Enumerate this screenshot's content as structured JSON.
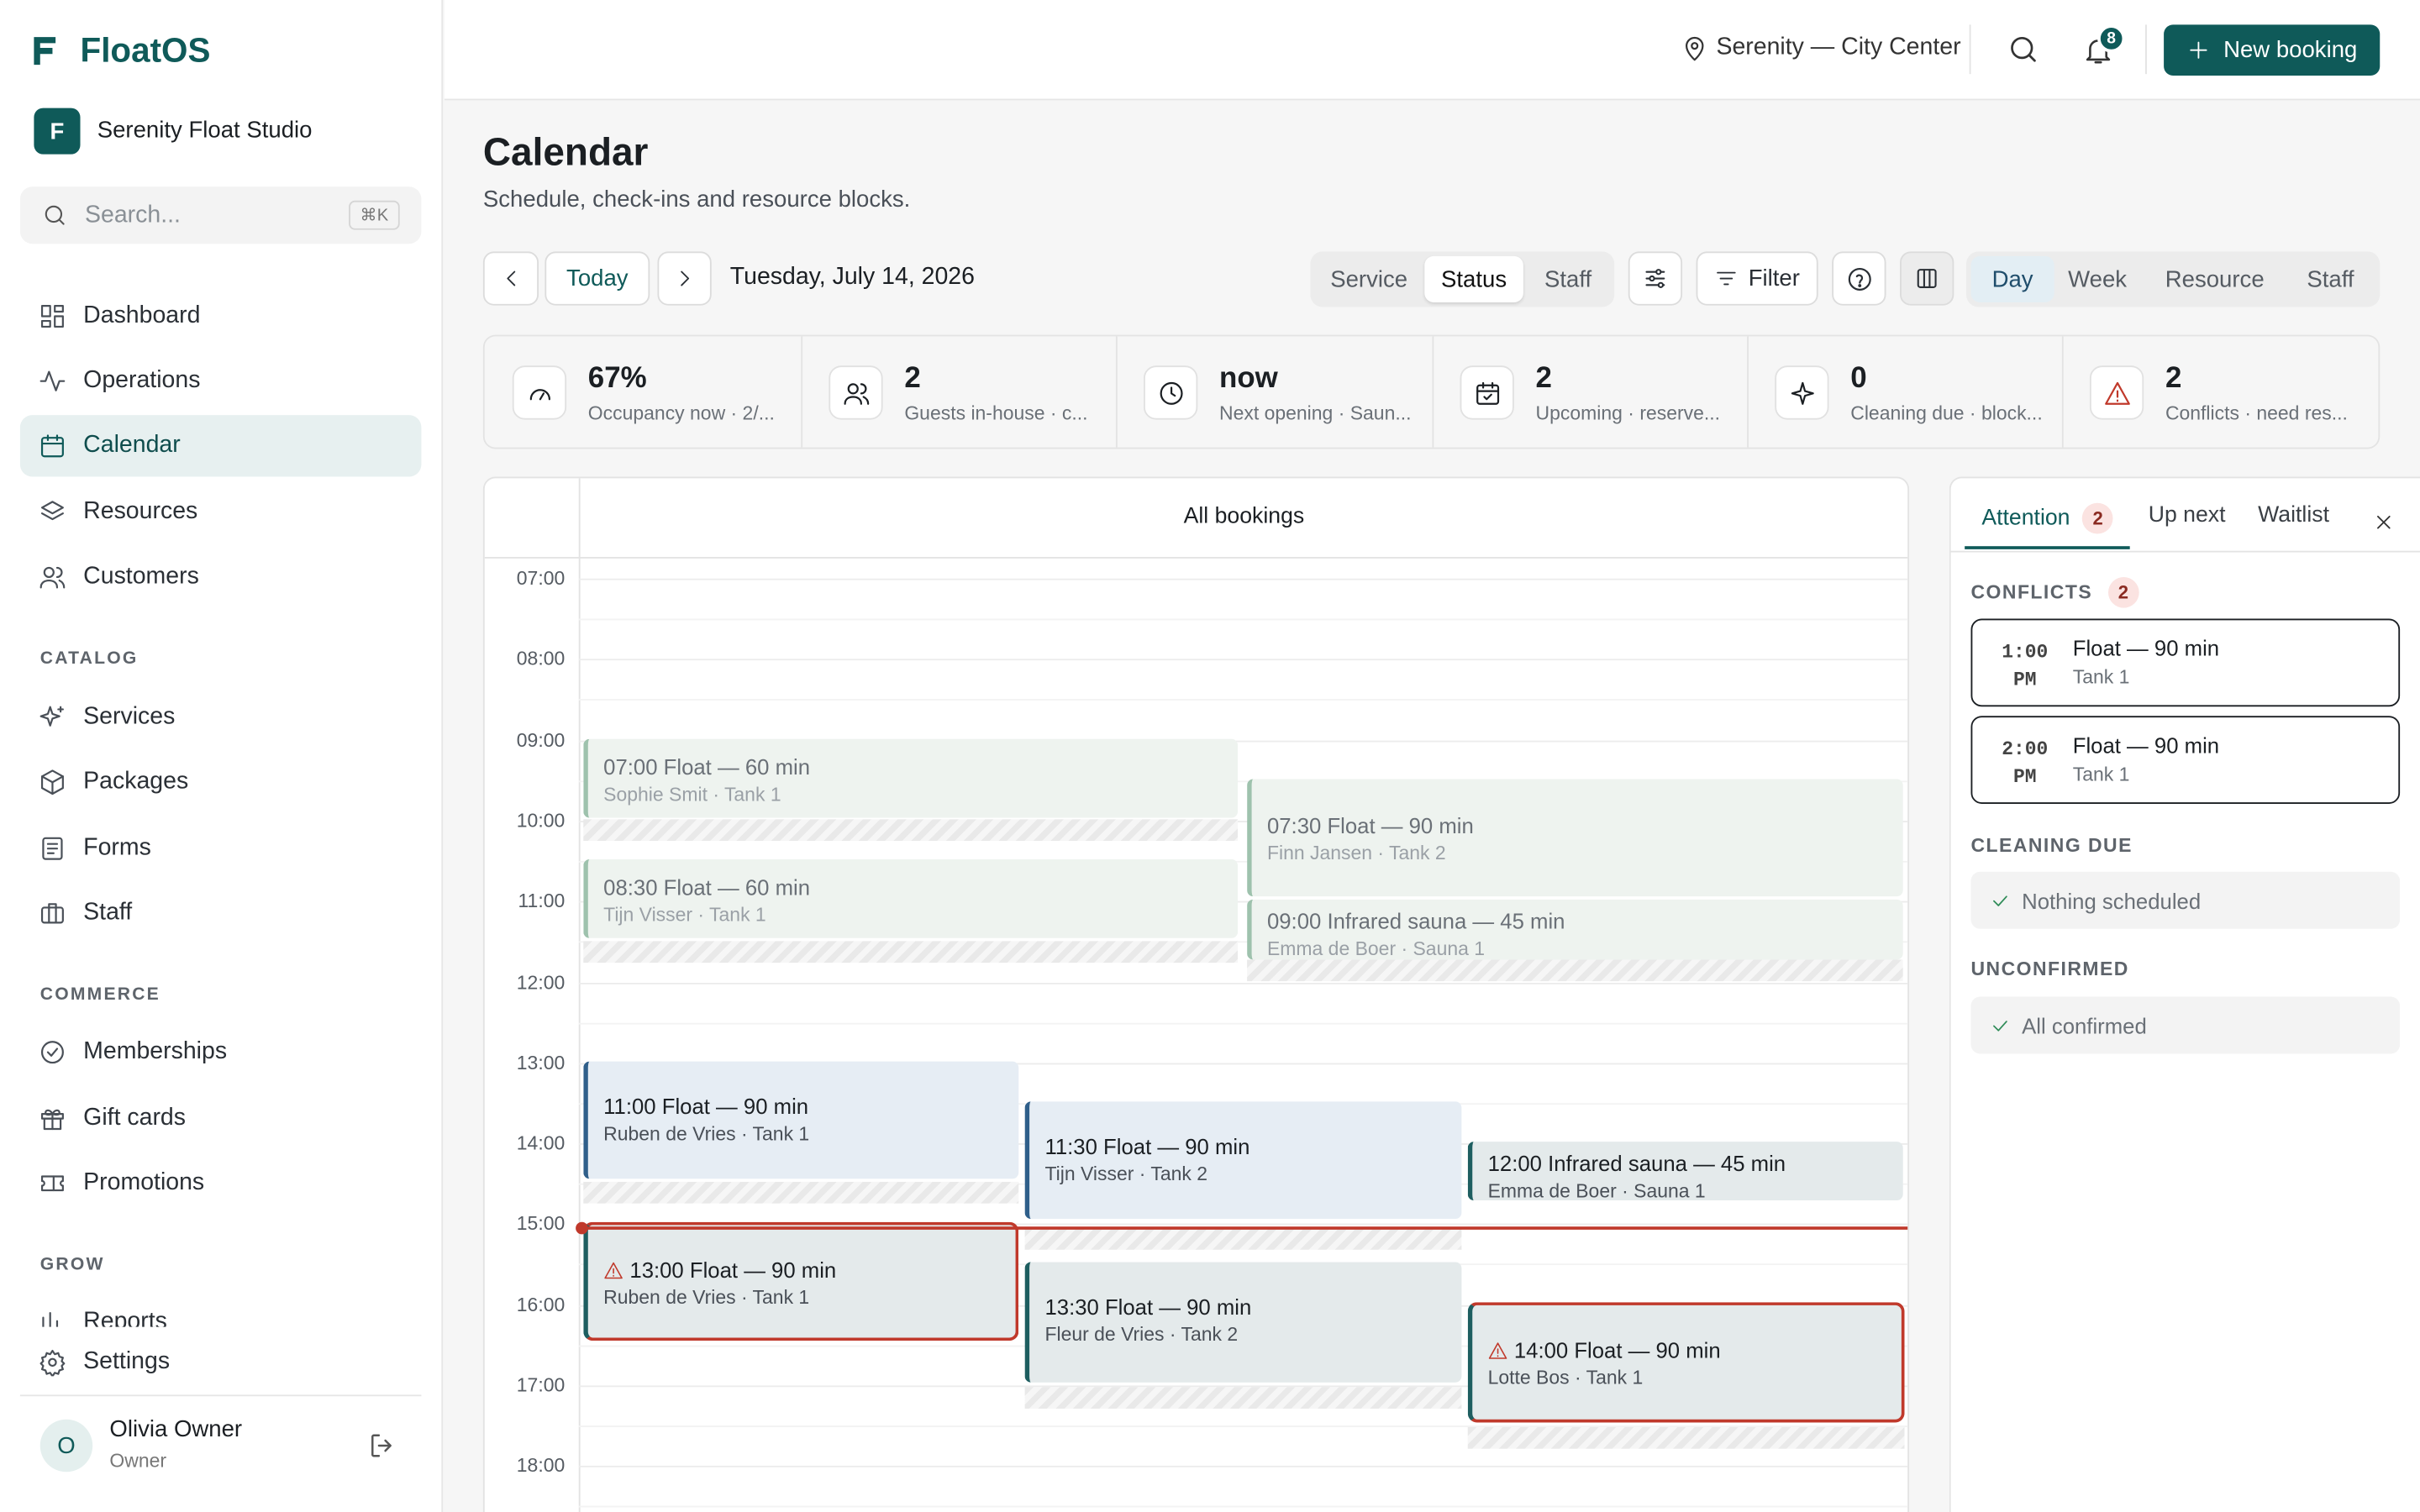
{
  "app": {
    "name": "FloatOS"
  },
  "studio": {
    "name": "Serenity Float Studio",
    "logo_letter": "F"
  },
  "search": {
    "placeholder": "Search...",
    "shortcut": "⌘K"
  },
  "nav": {
    "main": [
      {
        "label": "Dashboard",
        "icon": "dashboard-icon"
      },
      {
        "label": "Operations",
        "icon": "activity-icon"
      },
      {
        "label": "Calendar",
        "icon": "calendar-icon",
        "active": true
      },
      {
        "label": "Resources",
        "icon": "layers-icon"
      },
      {
        "label": "Customers",
        "icon": "users-icon"
      }
    ],
    "catalog_title": "CATALOG",
    "catalog": [
      {
        "label": "Services",
        "icon": "sparkles-icon"
      },
      {
        "label": "Packages",
        "icon": "package-icon"
      },
      {
        "label": "Forms",
        "icon": "form-icon"
      },
      {
        "label": "Staff",
        "icon": "briefcase-icon"
      }
    ],
    "commerce_title": "COMMERCE",
    "commerce": [
      {
        "label": "Memberships",
        "icon": "check-circle-icon"
      },
      {
        "label": "Gift cards",
        "icon": "gift-icon"
      },
      {
        "label": "Promotions",
        "icon": "ticket-icon"
      }
    ],
    "grow_title": "GROW",
    "grow": [
      {
        "label": "Reports",
        "icon": "bar-chart-icon"
      }
    ],
    "settings": "Settings"
  },
  "user": {
    "initial": "O",
    "name": "Olivia Owner",
    "role": "Owner"
  },
  "header": {
    "location": "Serenity — City Center",
    "notifications": "8",
    "new_booking": "New booking"
  },
  "page": {
    "title": "Calendar",
    "subtitle": "Schedule, check-ins and resource blocks."
  },
  "toolbar": {
    "today": "Today",
    "date": "Tuesday, July 14, 2026",
    "color_by": [
      "Service",
      "Status",
      "Staff"
    ],
    "color_by_active": "Status",
    "filter": "Filter",
    "views": [
      "Day",
      "Week",
      "Resource",
      "Staff"
    ],
    "view_active": "Day"
  },
  "kpis": [
    {
      "value": "67%",
      "label": "Occupancy now · 2/...",
      "icon": "gauge-icon"
    },
    {
      "value": "2",
      "label": "Guests in-house · c...",
      "icon": "users-icon"
    },
    {
      "value": "now",
      "label": "Next opening · Saun...",
      "icon": "clock-icon"
    },
    {
      "value": "2",
      "label": "Upcoming · reserve...",
      "icon": "calendar-check-icon"
    },
    {
      "value": "0",
      "label": "Cleaning due · block...",
      "icon": "sparkle-icon"
    },
    {
      "value": "2",
      "label": "Conflicts · need res...",
      "icon": "warning-icon"
    }
  ],
  "calendar": {
    "column_title": "All bookings",
    "hours": [
      "07:00",
      "08:00",
      "09:00",
      "10:00",
      "11:00",
      "12:00",
      "13:00",
      "14:00",
      "15:00",
      "16:00",
      "17:00",
      "18:00"
    ],
    "bookings": [
      {
        "title": "07:00 Float — 60 min",
        "sub": "Sophie Smit · Tank 1"
      },
      {
        "title": "07:30 Float — 90 min",
        "sub": "Finn Jansen · Tank 2"
      },
      {
        "title": "08:30 Float — 60 min",
        "sub": "Tijn Visser · Tank 1"
      },
      {
        "title": "09:00 Infrared sauna — 45 min",
        "sub": "Emma de Boer · Sauna 1"
      },
      {
        "title": "11:00 Float — 90 min",
        "sub": "Ruben de Vries · Tank 1"
      },
      {
        "title": "11:30 Float — 90 min",
        "sub": "Tijn Visser · Tank 2"
      },
      {
        "title": "12:00 Infrared sauna — 45 min",
        "sub": "Emma de Boer · Sauna 1"
      },
      {
        "title": "13:00 Float — 90 min",
        "sub": "Ruben de Vries · Tank 1"
      },
      {
        "title": "13:30 Float — 90 min",
        "sub": "Fleur de Vries · Tank 2"
      },
      {
        "title": "14:00 Float — 90 min",
        "sub": "Lotte Bos · Tank 1"
      }
    ]
  },
  "panel": {
    "tabs": [
      "Attention",
      "Up next",
      "Waitlist"
    ],
    "attention_count": "2",
    "conflicts_title": "CONFLICTS",
    "conflicts_count": "2",
    "conflicts": [
      {
        "time": "1:00",
        "ampm": "PM",
        "title": "Float — 90 min",
        "resource": "Tank 1"
      },
      {
        "time": "2:00",
        "ampm": "PM",
        "title": "Float — 90 min",
        "resource": "Tank 1"
      }
    ],
    "cleaning_title": "CLEANING DUE",
    "cleaning_empty": "Nothing scheduled",
    "unconfirmed_title": "UNCONFIRMED",
    "unconfirmed_empty": "All confirmed"
  },
  "colors": {
    "brand": "#0f5a59",
    "conflict": "#c0392b",
    "now_line": "#c0392b"
  }
}
